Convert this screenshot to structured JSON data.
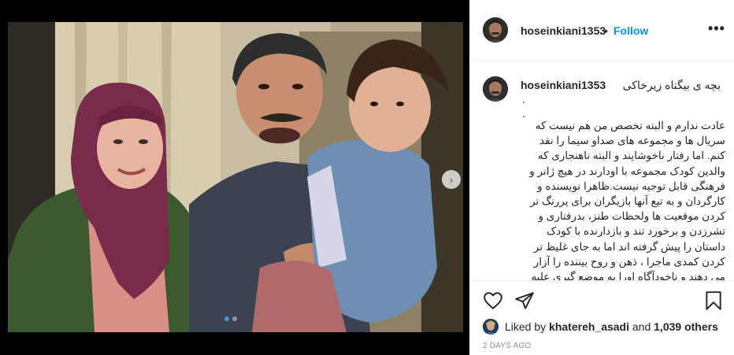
{
  "post": {
    "username": "hoseinkiani1353",
    "separator": "•",
    "follow_label": "Follow",
    "more_label": "•••"
  },
  "caption": {
    "username": "hoseinkiani1353",
    "title": "بچه ی بیگناه زیرخاکی",
    "dots": ".\n.",
    "body": "عادت ندارم و البته تخصص من هم نیست که سریال ها و مجموعه های صداو سیما را نقد کنم. اما رفتار ناخوشایند و البته ناهنجاری که والدین کودک مجموعه با اودارند در هیچ ژانر و فرهنگی قابل توجیه نیست.ظاهرا نویسنده و کارگردان و به تبع آنها بازیگران برای پررنگ تر کردن موقعیت ها ولحظات طنز، بدرفتاری و تشرزدن و برخورد تند و بازدارنده با کودک داستان را پیش گرفته اند اما به جای غلیظ تر کردن کمدی ماجرا ، ذهن و روح بیننده را آزار می دهند و ناخودآگاه اورا به موضع گیری علیه آزارگری و کودک آزاری وا می دارند و چنین امری"
  },
  "likes": {
    "prefix": "Liked by",
    "user": "khatereh_asadi",
    "middle": "and",
    "count": "1,039 others"
  },
  "date": "2 DAYS AGO",
  "media": {
    "active_slide": 1,
    "slide_count": 2,
    "next_arrow": "›"
  },
  "icons": {
    "heart": "heart-icon",
    "share": "share-icon",
    "save": "bookmark-icon",
    "more": "more-icon",
    "next": "chevron-right-icon"
  },
  "colors": {
    "follow": "#0095f6",
    "active_dot": "#3897f0",
    "muted": "#8e8e8e",
    "border": "#efefef"
  }
}
